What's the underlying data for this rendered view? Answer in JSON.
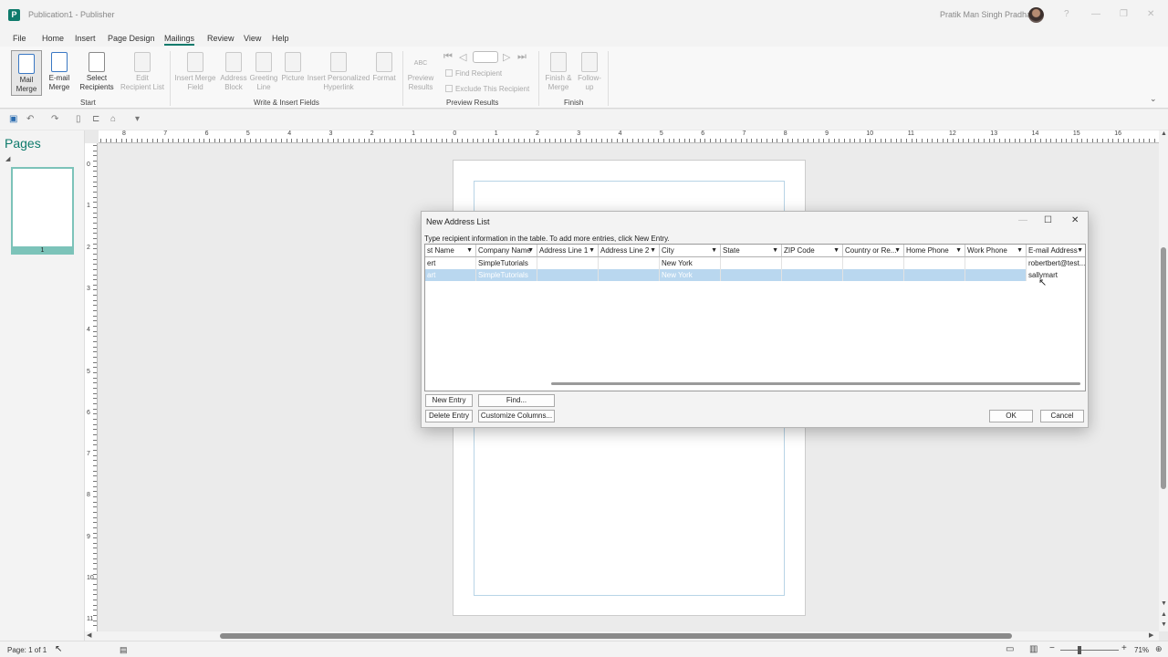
{
  "window": {
    "title": "Publication1 - Publisher",
    "user": "Pratik Man Singh Pradhan",
    "controls": [
      "?",
      "—",
      "❐",
      "✕"
    ]
  },
  "menu": [
    "File",
    "Home",
    "Insert",
    "Page Design",
    "Mailings",
    "Review",
    "View",
    "Help"
  ],
  "ribbon": {
    "start": {
      "label": "Start",
      "mail_merge": [
        "Mail",
        "Merge"
      ],
      "email_merge": [
        "E-mail",
        "Merge"
      ],
      "select_recipients": [
        "Select",
        "Recipients"
      ],
      "edit_recipient_list": [
        "Edit",
        "Recipient List"
      ]
    },
    "write_insert": {
      "label": "Write & Insert Fields",
      "insert_merge_field": [
        "Insert Merge",
        "Field"
      ],
      "address_block": [
        "Address",
        "Block"
      ],
      "greeting_line": [
        "Greeting",
        "Line"
      ],
      "picture": [
        "Picture"
      ],
      "insert_personalized_hyperlink": [
        "Insert Personalized",
        "Hyperlink"
      ],
      "format": [
        "Format"
      ]
    },
    "preview": {
      "label": "Preview Results",
      "preview_results": [
        "Preview",
        "Results"
      ],
      "abc": "ABC",
      "find_recipient": "Find Recipient",
      "exclude_recipient": "Exclude This Recipient"
    },
    "finish": {
      "label": "Finish",
      "finish_merge": [
        "Finish &",
        "Merge"
      ],
      "follow_up": [
        "Follow-",
        "up"
      ]
    }
  },
  "pages_pane": {
    "title": "Pages",
    "page_number": "1"
  },
  "rulers": {
    "horizontal": [
      "8",
      "7",
      "6",
      "5",
      "4",
      "3",
      "2",
      "1",
      "0",
      "1",
      "2",
      "3",
      "4",
      "5",
      "6",
      "7",
      "8",
      "9",
      "10",
      "11",
      "12",
      "13",
      "14",
      "15",
      "16"
    ],
    "vertical": [
      "0",
      "1",
      "2",
      "3",
      "4",
      "5",
      "6",
      "7",
      "8",
      "9",
      "10",
      "11"
    ]
  },
  "status": {
    "page": "Page: 1 of 1",
    "zoom": "71%"
  },
  "dialog": {
    "title": "New Address List",
    "instruction": "Type recipient information in the table.  To add more entries, click New Entry.",
    "columns": [
      "st Name",
      "Company Name",
      "Address Line 1",
      "Address Line 2",
      "City",
      "State",
      "ZIP Code",
      "Country or Re...",
      "Home Phone",
      "Work Phone",
      "E-mail Address"
    ],
    "rows": [
      [
        "ert",
        "SimpleTutorials",
        "",
        "",
        "New York",
        "",
        "",
        "",
        "",
        "",
        "robertbert@test..."
      ],
      [
        "art",
        "SimpleTutorials",
        "",
        "",
        "New York",
        "",
        "",
        "",
        "",
        "",
        "sallymart"
      ]
    ],
    "buttons": {
      "new_entry": "New Entry",
      "find": "Find...",
      "delete_entry": "Delete Entry",
      "customize_columns": "Customize Columns...",
      "ok": "OK",
      "cancel": "Cancel"
    }
  }
}
